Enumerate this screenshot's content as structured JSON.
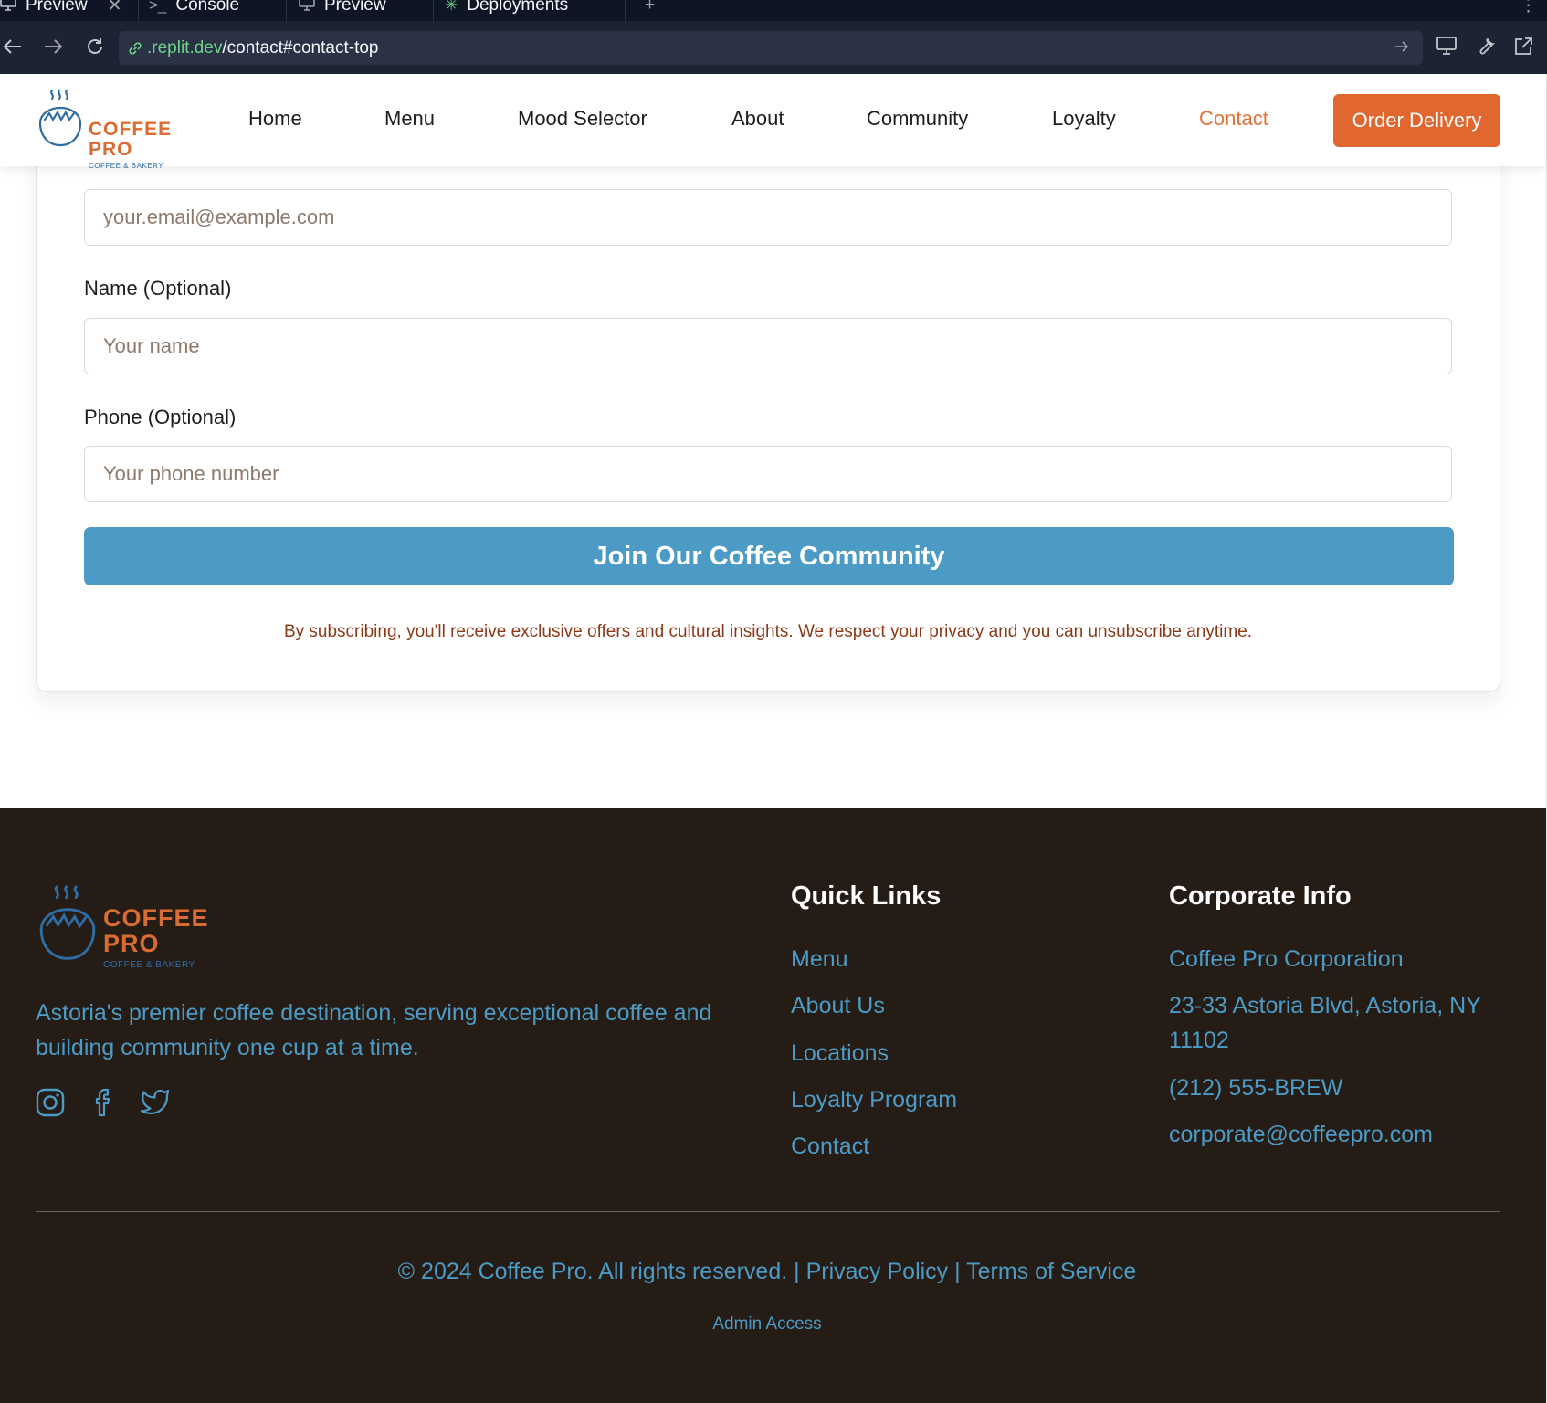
{
  "browser": {
    "tabs": [
      {
        "label": "Preview",
        "icon": "monitor-icon"
      },
      {
        "label": "Console",
        "icon": "terminal-icon"
      },
      {
        "label": "Preview",
        "icon": "monitor-icon"
      },
      {
        "label": "Deployments",
        "icon": "deploy-icon"
      }
    ],
    "url_host": ".replit.dev",
    "url_path": "/contact#contact-top"
  },
  "header": {
    "logo": {
      "line1": "COFFEE",
      "line2": "PRO",
      "sub": "COFFEE & BAKERY"
    },
    "nav": [
      "Home",
      "Menu",
      "Mood Selector",
      "About",
      "Community",
      "Loyalty",
      "Contact"
    ],
    "active_nav": "Contact",
    "order_button": "Order Delivery"
  },
  "form": {
    "email_placeholder": "your.email@example.com",
    "name_label": "Name (Optional)",
    "name_placeholder": "Your name",
    "phone_label": "Phone (Optional)",
    "phone_placeholder": "Your phone number",
    "submit": "Join Our Coffee Community",
    "disclaimer": "By subscribing, you'll receive exclusive offers and cultural insights. We respect your privacy and you can unsubscribe anytime."
  },
  "footer": {
    "logo": {
      "line1": "COFFEE",
      "line2": "PRO",
      "sub": "COFFEE & BAKERY"
    },
    "tagline": "Astoria's premier coffee destination, serving exceptional coffee and building community one cup at a time.",
    "social": [
      "instagram-icon",
      "facebook-icon",
      "twitter-icon"
    ],
    "quick_links_heading": "Quick Links",
    "quick_links": [
      "Menu",
      "About Us",
      "Locations",
      "Loyalty Program",
      "Contact"
    ],
    "corporate_heading": "Corporate Info",
    "corporate": {
      "name": "Coffee Pro Corporation",
      "address": "23-33 Astoria Blvd, Astoria, NY 11102",
      "phone": "(212) 555-BREW",
      "email": "corporate@coffeepro.com"
    },
    "copyright": "© 2024 Coffee Pro. All rights reserved. |",
    "privacy": "Privacy Policy",
    "separator": "|",
    "terms": "Terms of Service",
    "admin": "Admin Access"
  },
  "colors": {
    "accent_orange": "#e0672f",
    "accent_blue": "#4b9bc6",
    "footer_bg": "#261c16",
    "chrome_bg": "#1c2333"
  }
}
